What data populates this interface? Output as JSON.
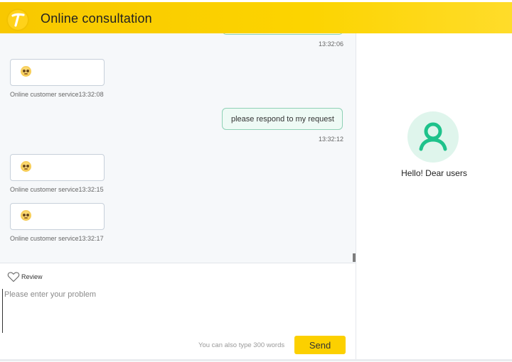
{
  "header": {
    "title": "Online consultation",
    "brand_color": "#fcd000"
  },
  "chat": {
    "messages": [
      {
        "sender": "user",
        "text": "",
        "time": "13:32:06"
      },
      {
        "sender": "agent",
        "content": "pleading-face-emoji",
        "meta": "Online customer service13:32:08"
      },
      {
        "sender": "user",
        "text": "please respond to my request",
        "time": "13:32:12"
      },
      {
        "sender": "agent",
        "content": "pleading-face-emoji",
        "meta": "Online customer service13:32:15"
      },
      {
        "sender": "agent",
        "content": "pleading-face-emoji",
        "meta": "Online customer service13:32:17"
      }
    ]
  },
  "input": {
    "review_label": "Review",
    "placeholder": "Please enter your problem",
    "value": "",
    "word_hint": "You can also type 300 words",
    "send_label": "Send"
  },
  "profile": {
    "greeting": "Hello! Dear users",
    "avatar_color": "#1ec28b"
  }
}
